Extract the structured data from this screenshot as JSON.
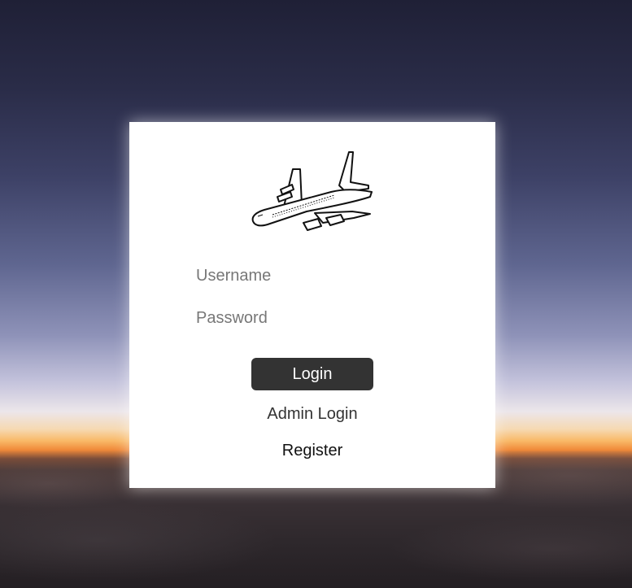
{
  "login_form": {
    "username_placeholder": "Username",
    "password_placeholder": "Password",
    "login_label": "Login",
    "admin_login_label": "Admin Login",
    "register_label": "Register"
  },
  "icons": {
    "logo": "airplane-icon"
  },
  "colors": {
    "card_background": "#ffffff",
    "button_background": "#333333",
    "button_text": "#ffffff"
  }
}
